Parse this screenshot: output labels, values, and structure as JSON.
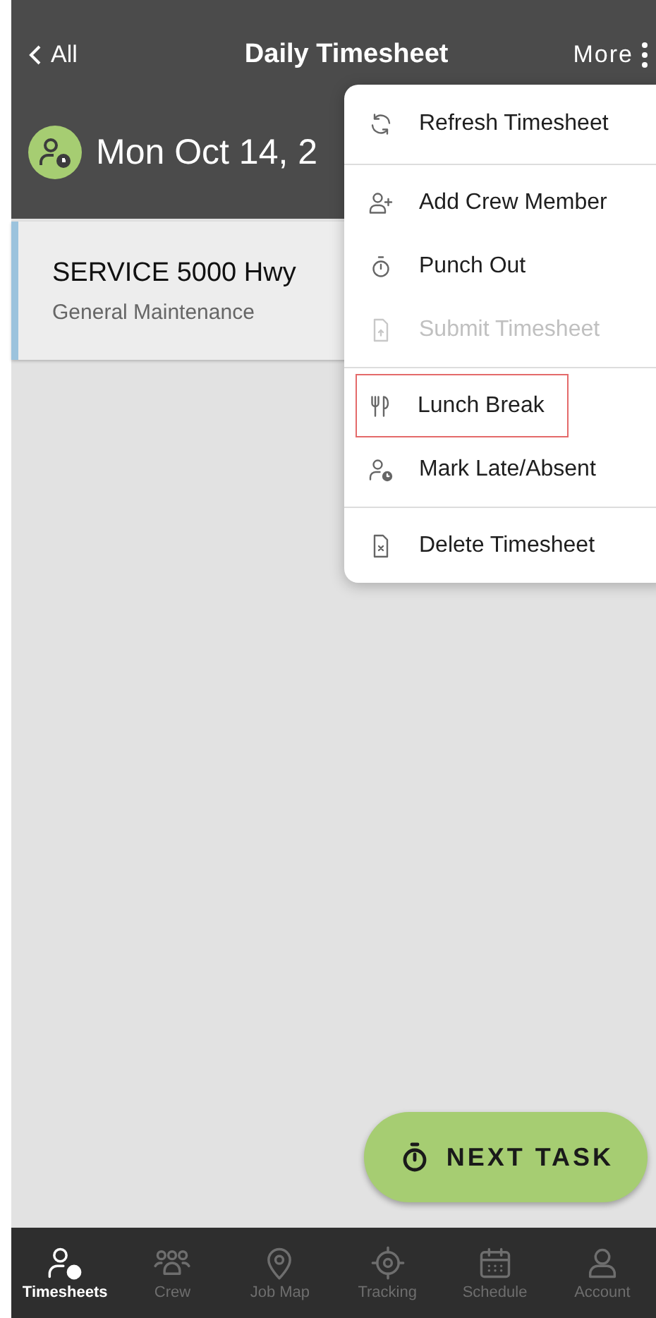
{
  "top_bar": {
    "back": "All",
    "title": "Daily Timesheet",
    "more": "More"
  },
  "date_header": {
    "date": "Mon Oct 14, 2"
  },
  "task_card": {
    "title": "SERVICE 5000 Hwy",
    "subtitle": "General Maintenance"
  },
  "menu": {
    "groups": [
      [
        {
          "label": "Refresh Timesheet",
          "disabled": false,
          "highlighted": false
        }
      ],
      [
        {
          "label": "Add Crew Member",
          "disabled": false,
          "highlighted": false
        },
        {
          "label": "Punch Out",
          "disabled": false,
          "highlighted": false
        },
        {
          "label": "Submit Timesheet",
          "disabled": true,
          "highlighted": false
        }
      ],
      [
        {
          "label": "Lunch Break",
          "disabled": false,
          "highlighted": true
        },
        {
          "label": "Mark Late/Absent",
          "disabled": false,
          "highlighted": false
        }
      ],
      [
        {
          "label": "Delete Timesheet",
          "disabled": false,
          "highlighted": false
        }
      ]
    ]
  },
  "fab": {
    "label": "NEXT TASK"
  },
  "bottom_nav": [
    {
      "label": "Timesheets",
      "selected": true
    },
    {
      "label": "Crew",
      "selected": false
    },
    {
      "label": "Job Map",
      "selected": false
    },
    {
      "label": "Tracking",
      "selected": false
    },
    {
      "label": "Schedule",
      "selected": false
    },
    {
      "label": "Account",
      "selected": false
    }
  ]
}
